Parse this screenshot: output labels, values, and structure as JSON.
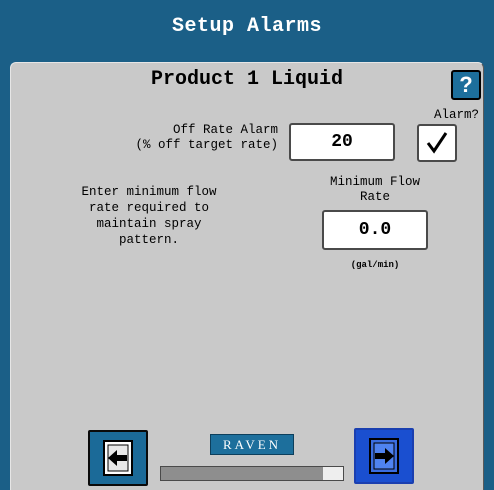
{
  "window": {
    "title": "Setup Alarms"
  },
  "product": {
    "title": "Product 1 Liquid"
  },
  "help": {
    "label": "?",
    "icon": "help-icon"
  },
  "off_rate": {
    "label_line1": "Off Rate Alarm",
    "label_line2": "(% off target rate)",
    "value": "20"
  },
  "alarm": {
    "label": "Alarm?",
    "checked": true
  },
  "min_flow": {
    "description": [
      "Enter minimum flow",
      "rate required to",
      "maintain spray",
      "pattern."
    ],
    "label_line1": "Minimum Flow",
    "label_line2": "Rate",
    "value": "0.0",
    "unit": "(gal/min)"
  },
  "footer": {
    "brand": "RAVEN",
    "progress_fraction": 0.89,
    "back_icon": "back-page-icon",
    "next_icon": "next-page-icon"
  },
  "colors": {
    "title_bar": "#1b5f87",
    "panel": "#c9c9c9",
    "next_button": "#1a4fd0"
  }
}
